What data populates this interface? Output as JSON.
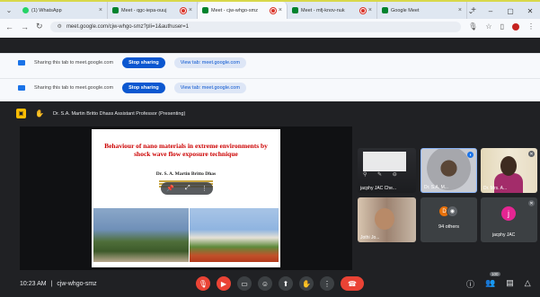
{
  "tabs": [
    {
      "title": "(1) WhatsApp",
      "fav": "#25d366",
      "rec": false
    },
    {
      "title": "Meet - qgc-iepa-ouuj",
      "fav": "#00832d",
      "rec": true
    },
    {
      "title": "Meet - cjw-whgo-smz",
      "fav": "#00832d",
      "rec": true,
      "active": true
    },
    {
      "title": "Meet - mfj-knov-nuk",
      "fav": "#00832d",
      "rec": true
    },
    {
      "title": "Google Meet",
      "fav": "#00832d",
      "rec": false
    }
  ],
  "address": {
    "url": "meet.google.com/cjw-whgo-smz?pli=1&authuser=1"
  },
  "sharing": [
    {
      "text": "Sharing this tab to meet.google.com",
      "stop": "Stop sharing",
      "view": "View tab: meet.google.com"
    },
    {
      "text": "Sharing this tab to meet.google.com",
      "stop": "Stop sharing",
      "view": "View tab: meet.google.com"
    }
  ],
  "presenter": {
    "text": "Dr. S.A. Martin Britto Dhass Assistant Professor (Presenting)"
  },
  "slide": {
    "title": "Behaviour of nano materials in extreme environments by shock wave flow exposure technique",
    "author": "Dr. S. A. Martin Britto Dhas"
  },
  "tiles": [
    {
      "name": "jacphy JAC Che..."
    },
    {
      "name": "Dr. S.A. M..."
    },
    {
      "name": "Dr. Mrs. A..."
    },
    {
      "name": "Jothi Jo..."
    },
    {
      "name": "94 others",
      "initial1": "D"
    },
    {
      "name": "jacphy JAC",
      "initial": "j"
    }
  ],
  "bottom": {
    "time": "10:23 AM",
    "separator": "|",
    "code": "cjw-whgo-smz",
    "people_count": "100"
  }
}
